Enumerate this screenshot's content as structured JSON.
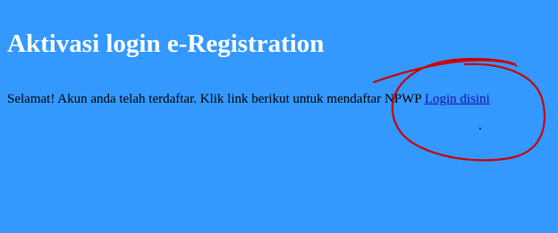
{
  "page": {
    "title": "Aktivasi login e-Registration",
    "message": "Selamat! Akun anda telah terdaftar. Klik link berikut untuk mendaftar NPWP",
    "login_link_label": "Login disini"
  },
  "colors": {
    "background": "#3399ff",
    "title": "#ffffff",
    "text": "#000000",
    "link": "#1a0dab",
    "annotation": "#cc0000"
  }
}
